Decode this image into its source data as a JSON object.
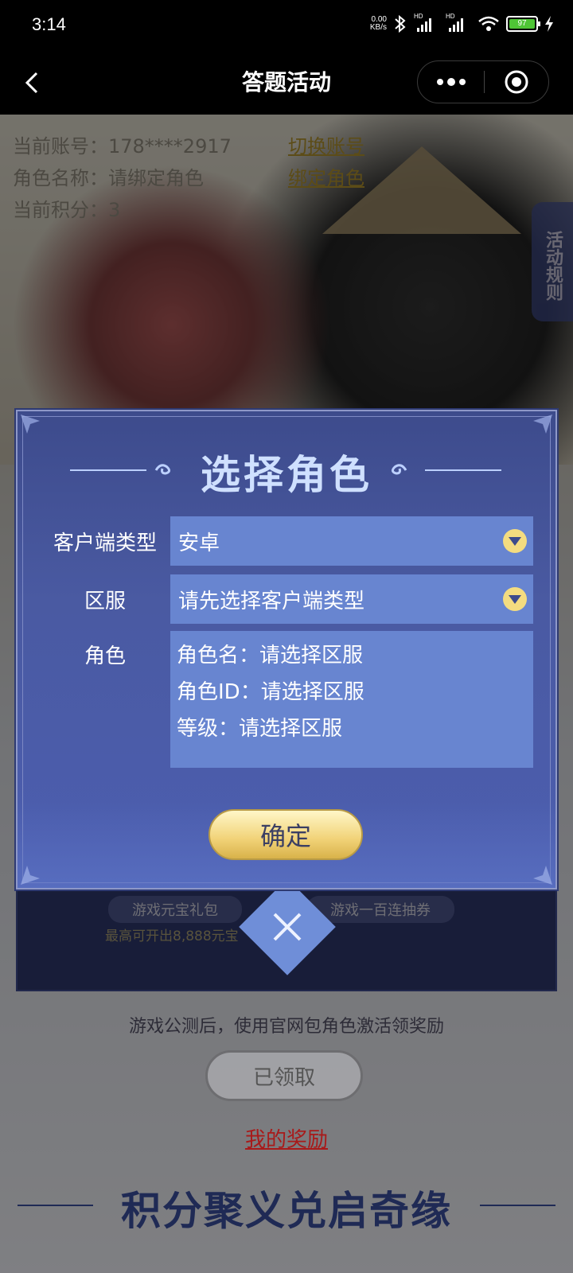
{
  "status_bar": {
    "time": "3:14",
    "net_speed_value": "0.00",
    "net_speed_unit": "KB/s",
    "sim1": "HD",
    "sim2": "HD",
    "battery": "97"
  },
  "header": {
    "title": "答题活动"
  },
  "account": {
    "current_account_label": "当前账号：",
    "current_account_value": "178****2917",
    "switch_account": "切换账号",
    "role_name_label": "角色名称：",
    "role_name_value": "请绑定角色",
    "bind_role": "绑定角色",
    "points_label": "当前积分：",
    "points_value": "3"
  },
  "rules_tab": "活动规则",
  "background": {
    "reward1_name": "游戏元宝礼包",
    "reward1_desc": "最高可开出8,888元宝",
    "reward2_name": "游戏一百连抽券",
    "notice": "游戏公测后，使用官网包角色激活领奖励",
    "claimed_button": "已领取",
    "my_rewards": "我的奖励",
    "bottom_title": "积分聚义兑启奇缘"
  },
  "modal": {
    "title": "选择角色",
    "client_type_label": "客户端类型",
    "client_type_value": "安卓",
    "server_label": "区服",
    "server_value": "请先选择客户端类型",
    "role_label": "角色",
    "role_name_line": "角色名：请选择区服",
    "role_id_line": "角色ID：请选择区服",
    "level_line": "等级：请选择区服",
    "confirm_button": "确定"
  },
  "colors": {
    "modal_bg": "#4a5aa2",
    "field_bg": "#6885d0",
    "dropdown_accent": "#f4dc80",
    "confirm_gold": "#f1d277",
    "link_red": "#a81a1a"
  }
}
